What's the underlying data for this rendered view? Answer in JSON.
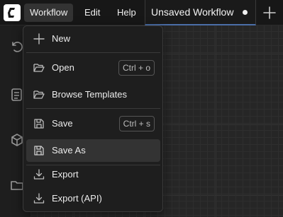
{
  "colors": {
    "accent": "#4b6ea8",
    "background": "#1f1f1f",
    "menu_background": "#1e1e1e",
    "hover": "#333333"
  },
  "topbar": {
    "logo_icon": "comfy-logo-icon",
    "menus": [
      {
        "label": "Workflow",
        "active": true
      },
      {
        "label": "Edit"
      },
      {
        "label": "Help"
      }
    ],
    "tab": {
      "title": "Unsaved Workflow",
      "unsaved_indicator": "dot-icon"
    },
    "add_tab_icon": "plus-icon"
  },
  "sidebar": {
    "icons": [
      "history-icon",
      "queue-icon",
      "cube-icon",
      "folder-icon"
    ]
  },
  "workflow_menu": {
    "items": [
      {
        "label": "New",
        "icon": "plus-icon"
      },
      {
        "label": "Open",
        "icon": "folder-open-icon",
        "shortcut": "Ctrl + o"
      },
      {
        "label": "Browse Templates",
        "icon": "folder-open-icon"
      },
      {
        "label": "Save",
        "icon": "save-icon",
        "shortcut": "Ctrl + s"
      },
      {
        "label": "Save As",
        "icon": "save-icon",
        "highlighted": true
      },
      {
        "label": "Export",
        "icon": "download-icon"
      },
      {
        "label": "Export (API)",
        "icon": "download-icon"
      }
    ]
  }
}
